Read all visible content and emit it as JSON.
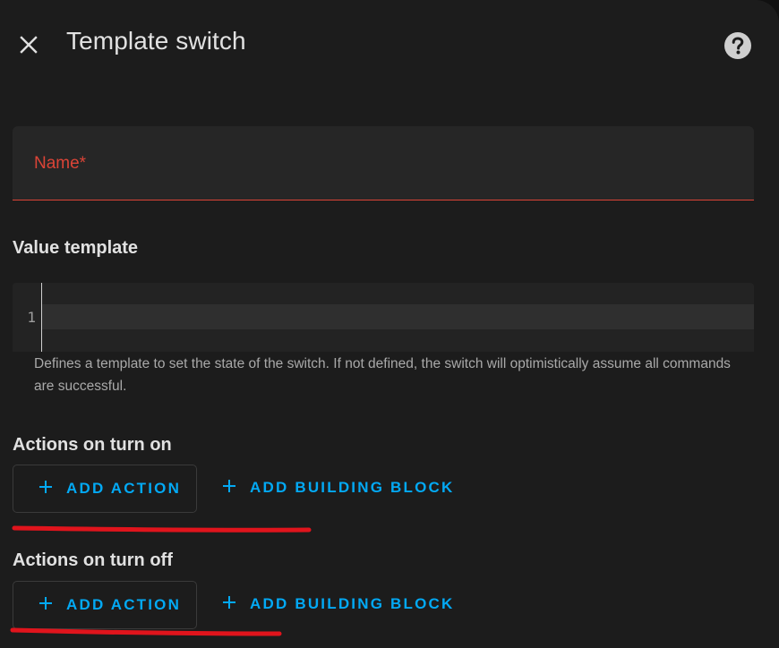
{
  "dialog": {
    "title": "Template switch"
  },
  "form": {
    "name_label": "Name*",
    "value_template": {
      "heading": "Value template",
      "line_number": "1",
      "helper": "Defines a template to set the state of the switch. If not defined, the switch will optimistically assume all commands are successful."
    },
    "turn_on": {
      "heading": "Actions on turn on",
      "add_action": "ADD ACTION",
      "add_building_block": "ADD BUILDING BLOCK"
    },
    "turn_off": {
      "heading": "Actions on turn off",
      "add_action": "ADD ACTION",
      "add_building_block": "ADD BUILDING BLOCK"
    }
  },
  "icons": {
    "close": "close-icon",
    "help": "help-circle-icon",
    "plus": "plus-icon"
  },
  "colors": {
    "accent": "#03a9f4",
    "error": "#db4437",
    "annotation": "#e0141c",
    "background": "#1c1c1c"
  }
}
